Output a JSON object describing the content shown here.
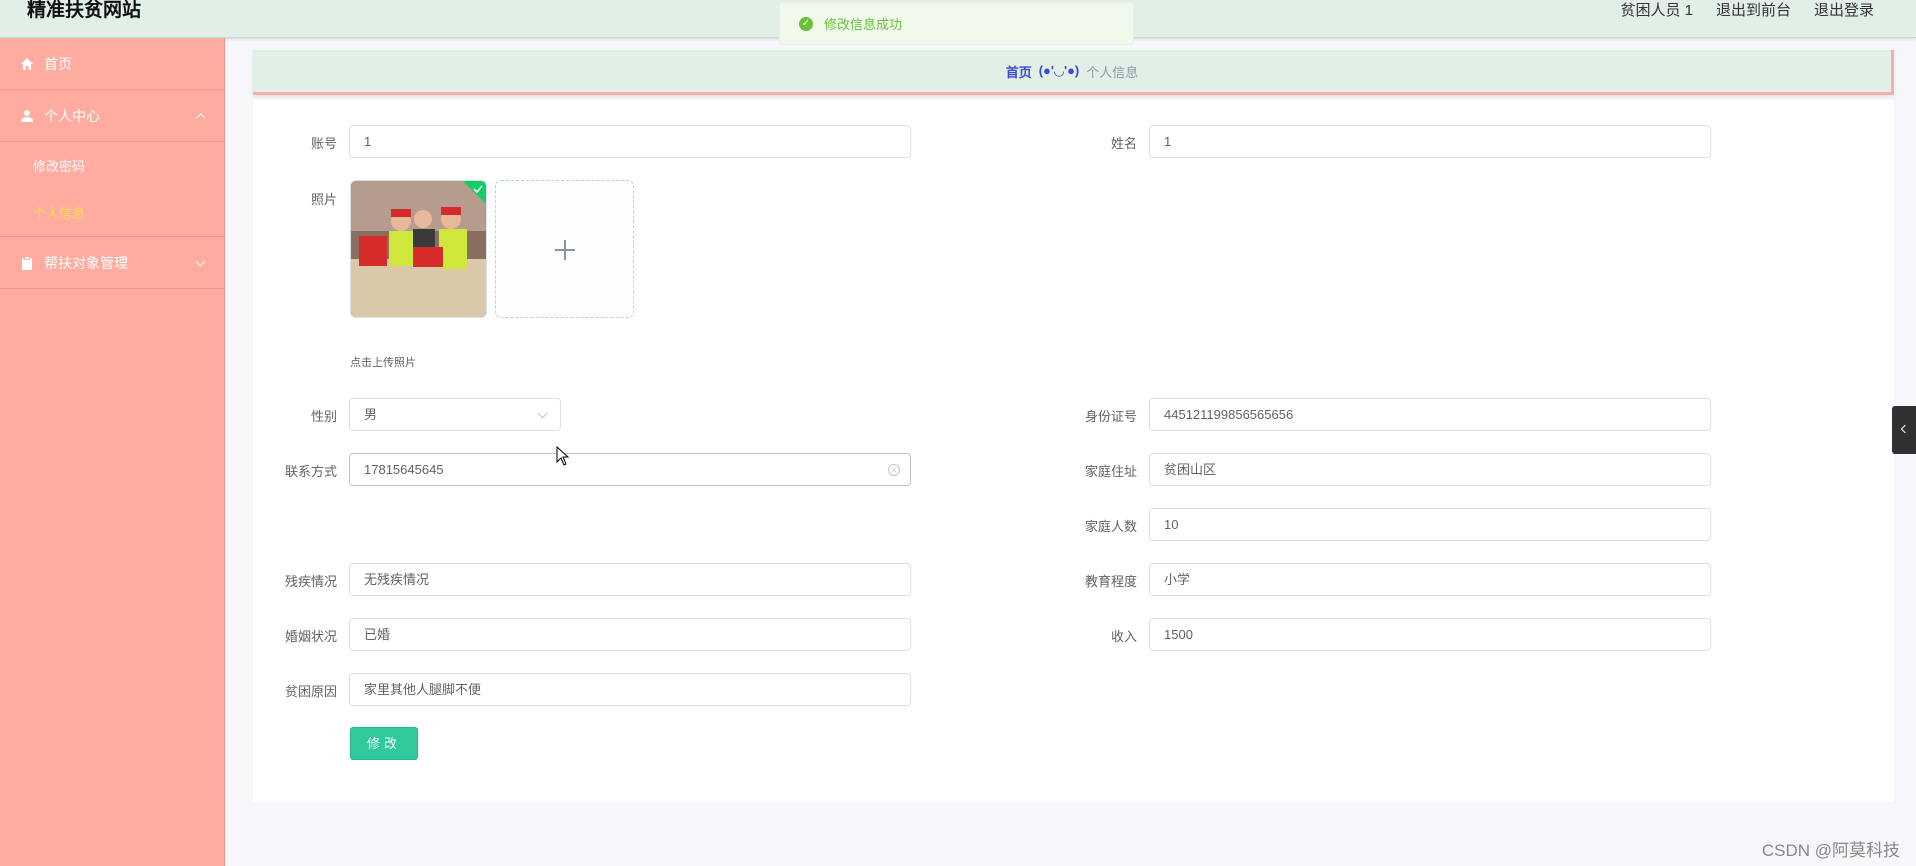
{
  "header": {
    "brand": "精准扶贫网站",
    "user_label": "贫困人员 1",
    "back_to_front": "退出到前台",
    "logout": "退出登录"
  },
  "toast": {
    "message": "修改信息成功"
  },
  "sidebar": {
    "home": "首页",
    "personal_center": "个人中心",
    "change_password": "修改密码",
    "personal_info": "个人信息",
    "object_management": "帮扶对象管理"
  },
  "breadcrumb": {
    "home": "首页",
    "separator": "(●'◡'●)",
    "current": "个人信息"
  },
  "form": {
    "account_label": "账号",
    "account_value": "1",
    "name_label": "姓名",
    "name_value": "1",
    "photo_label": "照片",
    "upload_tip": "点击上传照片",
    "gender_label": "性别",
    "gender_value": "男",
    "id_label": "身份证号",
    "id_value": "445121199856565656",
    "contact_label": "联系方式",
    "contact_value": "17815645645",
    "address_label": "家庭住址",
    "address_value": "贫困山区",
    "family_size_label": "家庭人数",
    "family_size_value": "10",
    "disability_label": "残疾情况",
    "disability_value": "无残疾情况",
    "education_label": "教育程度",
    "education_value": "小学",
    "marriage_label": "婚姻状况",
    "marriage_value": "已婚",
    "income_label": "收入",
    "income_value": "1500",
    "poverty_reason_label": "贫困原因",
    "poverty_reason_value": "家里其他人腿脚不便",
    "submit_label": "修改"
  },
  "watermark": "CSDN @阿莫科技",
  "colors": {
    "sidebar_bg": "#ffaba0",
    "topbar_bg": "#e1efe7",
    "active_menu": "#ffe14a",
    "submit_bg": "#30c99b",
    "success": "#67c23a"
  }
}
